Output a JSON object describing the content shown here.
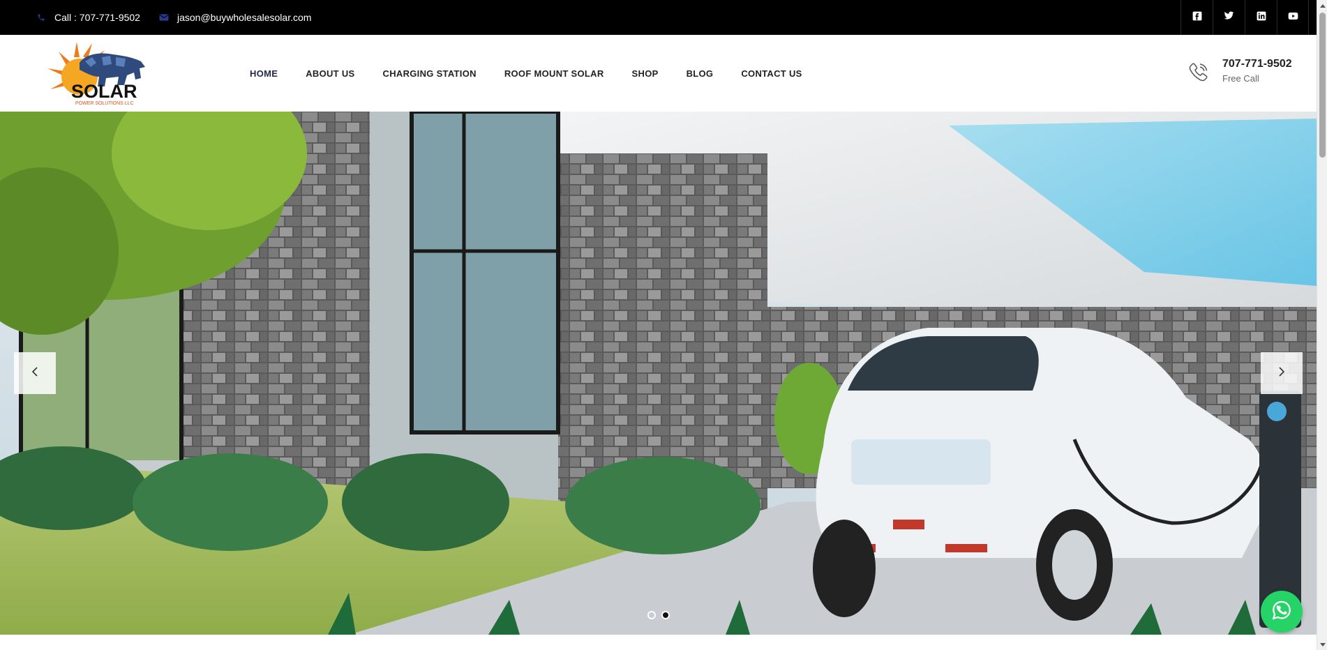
{
  "topbar": {
    "call_text": "Call : 707-771-9502",
    "call_icon": "phone-icon",
    "email_text": "jason@buywholesalesolar.com",
    "email_icon": "envelope-icon",
    "social": [
      "facebook-icon",
      "twitter-icon",
      "linkedin-icon",
      "youtube-icon"
    ]
  },
  "header": {
    "logo": {
      "word": "SOLAR",
      "tagline": "POWER SOLUTIONS LLC"
    },
    "nav": [
      {
        "label": "HOME",
        "active": true
      },
      {
        "label": "ABOUT US",
        "active": false
      },
      {
        "label": "CHARGING STATION",
        "active": false
      },
      {
        "label": "ROOF MOUNT SOLAR",
        "active": false
      },
      {
        "label": "SHOP",
        "active": false
      },
      {
        "label": "BLOG",
        "active": false
      },
      {
        "label": "CONTACT US",
        "active": false
      }
    ],
    "phone": "707-771-9502",
    "phone_sub": "Free Call"
  },
  "hero": {
    "slide_count": 2,
    "active_slide": 2
  },
  "colors": {
    "topbar_bg": "#000000",
    "nav_text": "#222222",
    "whatsapp": "#25d366",
    "logo_orange": "#f07b1d",
    "logo_navy": "#1f2a44"
  }
}
